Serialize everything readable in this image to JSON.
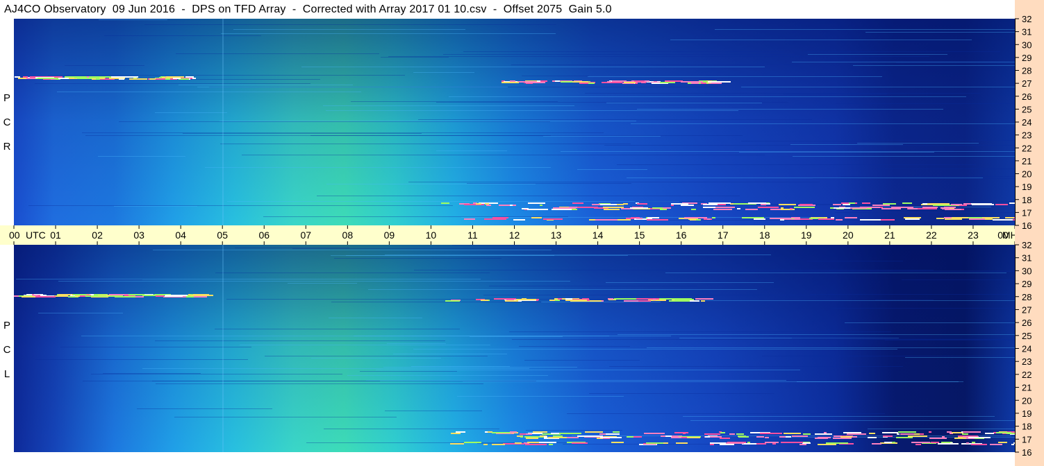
{
  "title": "AJ4CO Observatory  09 Jun 2016  -  DPS on TFD Array  -  Corrected with Array 2017 01 10.csv  -  Offset 2075  Gain 5.0",
  "panels": [
    {
      "name": "rcp",
      "polarization_label": [
        "P",
        "C",
        "R"
      ]
    },
    {
      "name": "lcp",
      "polarization_label": [
        "P",
        "C",
        "L"
      ]
    }
  ],
  "time_axis": {
    "labels": [
      "00",
      "01",
      "02",
      "03",
      "04",
      "05",
      "06",
      "07",
      "08",
      "09",
      "10",
      "11",
      "12",
      "13",
      "14",
      "15",
      "16",
      "17",
      "18",
      "19",
      "20",
      "21",
      "22",
      "23",
      "00"
    ],
    "unit_label": "UTC",
    "end_unit_label": "MHz"
  },
  "frequency_axis": {
    "labels": [
      "32",
      "31",
      "30",
      "29",
      "28",
      "27",
      "26",
      "25",
      "24",
      "23",
      "22",
      "21",
      "20",
      "19",
      "18",
      "17",
      "16"
    ]
  },
  "colors": {
    "title_bg": "#ffffff",
    "time_axis_bg": "#ffffcc",
    "freq_axis_bg": "#ffdcbf",
    "spectrogram_dark": "#0a1b6e",
    "spectrogram_mid": "#1f7fe0",
    "spectrogram_bright": "#4ff0a0"
  },
  "chart_data": {
    "type": "heatmap",
    "title": "AJ4CO Observatory  09 Jun 2016  -  DPS on TFD Array  -  Corrected with Array 2017 01 10.csv  -  Offset 2075  Gain 5.0",
    "xlabel": "UTC",
    "ylabel": "MHz",
    "xlim": [
      0,
      24
    ],
    "ylim": [
      16,
      32
    ],
    "x_ticks": [
      "00",
      "01",
      "02",
      "03",
      "04",
      "05",
      "06",
      "07",
      "08",
      "09",
      "10",
      "11",
      "12",
      "13",
      "14",
      "15",
      "16",
      "17",
      "18",
      "19",
      "20",
      "21",
      "22",
      "23",
      "00"
    ],
    "y_ticks": [
      "16",
      "17",
      "18",
      "19",
      "20",
      "21",
      "22",
      "23",
      "24",
      "25",
      "26",
      "27",
      "28",
      "29",
      "30",
      "31",
      "32"
    ],
    "series": [
      {
        "name": "RCP"
      },
      {
        "name": "LCP"
      }
    ]
  }
}
